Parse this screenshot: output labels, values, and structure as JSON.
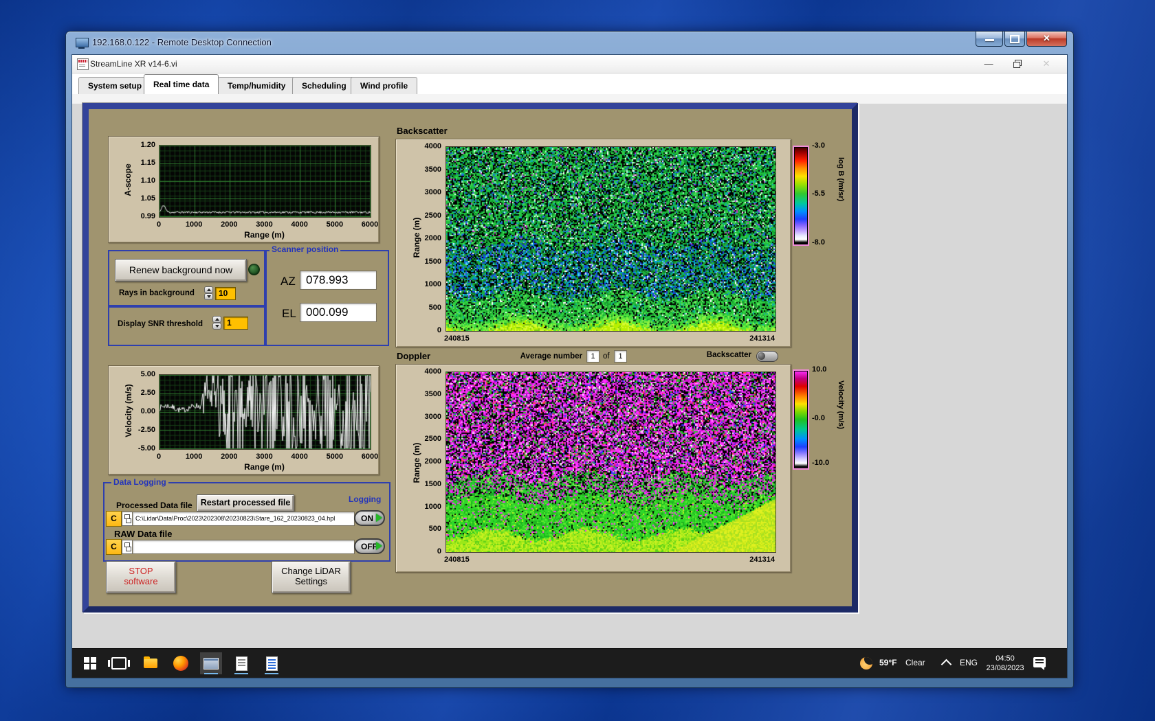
{
  "rdp_window": {
    "title": "192.168.0.122 - Remote Desktop Connection"
  },
  "app_window": {
    "title": "StreamLine XR v14-6.vi",
    "tabs": [
      {
        "label": "System setup",
        "selected": false
      },
      {
        "label": "Real time data",
        "selected": true
      },
      {
        "label": "Temp/humidity",
        "selected": false
      },
      {
        "label": "Scheduling",
        "selected": false
      },
      {
        "label": "Wind profile",
        "selected": false
      }
    ]
  },
  "panel": {
    "ascope": {
      "ylabel": "A-scope",
      "xlabel": "Range (m)",
      "yticks": [
        "1.20",
        "1.15",
        "1.10",
        "1.05",
        "0.99"
      ],
      "xticks": [
        "0",
        "1000",
        "2000",
        "3000",
        "4000",
        "5000",
        "6000"
      ]
    },
    "controls": {
      "renew": "Renew background now",
      "rays_label": "Rays in background",
      "rays_value": "10",
      "snr_label": "Display SNR threshold",
      "snr_value": "1"
    },
    "scanner": {
      "title": "Scanner position",
      "az_label": "AZ",
      "az_value": "078.993",
      "el_label": "EL",
      "el_value": "000.099"
    },
    "backscatter": {
      "title": "Backscatter",
      "ylabel": "Range (m)",
      "yticks": [
        "4000",
        "3500",
        "3000",
        "2500",
        "2000",
        "1500",
        "1000",
        "500",
        "0"
      ],
      "time_start": "240815",
      "time_end": "241314",
      "colorbar_ticks": [
        "-3.0",
        "-5.5",
        "-8.0"
      ],
      "colorbar_label": "log B (/m/sr)"
    },
    "average": {
      "label": "Average number",
      "value": "1",
      "of": "of",
      "total": "1",
      "toggle_label": "Backscatter"
    },
    "doppler": {
      "title": "Doppler",
      "ylabel": "Range (m)",
      "yticks": [
        "4000",
        "3500",
        "3000",
        "2500",
        "2000",
        "1500",
        "1000",
        "500",
        "0"
      ],
      "time_start": "240815",
      "time_end": "241314",
      "colorbar_ticks": [
        "10.0",
        "-0.0",
        "-10.0"
      ],
      "colorbar_label": "Velocity (m/s)"
    },
    "velocity": {
      "ylabel": "Velocity (m/s)",
      "xlabel": "Range (m)",
      "yticks": [
        "5.00",
        "2.50",
        "0.00",
        "-2.50",
        "-5.00"
      ],
      "xticks": [
        "0",
        "1000",
        "2000",
        "3000",
        "4000",
        "5000",
        "6000"
      ]
    },
    "logging": {
      "title": "Data Logging",
      "processed_label": "Processed Data file",
      "restart": "Restart processed file",
      "logging_label": "Logging",
      "drive": "C",
      "processed_path": "C:\\Lidar\\Data\\Proc\\2023\\202308\\20230823\\Stare_162_20230823_04.hpl",
      "raw_label": "RAW Data file",
      "raw_path": "",
      "on": "ON",
      "off": "OFF"
    },
    "stop": {
      "line1": "STOP",
      "line2": "software"
    },
    "change": {
      "line1": "Change LiDAR",
      "line2": "Settings"
    }
  },
  "taskbar": {
    "temp": "59°F",
    "condition": "Clear",
    "lang": "ENG",
    "time": "04:50",
    "date": "23/08/2023"
  },
  "colors": {
    "panel_tan": "#a0946f",
    "group_tan": "#cfc3a9",
    "navy_border": "#1c2a66",
    "label_blue": "#2233bb",
    "amber": "#ffc000",
    "stop_red": "#cc2222"
  }
}
